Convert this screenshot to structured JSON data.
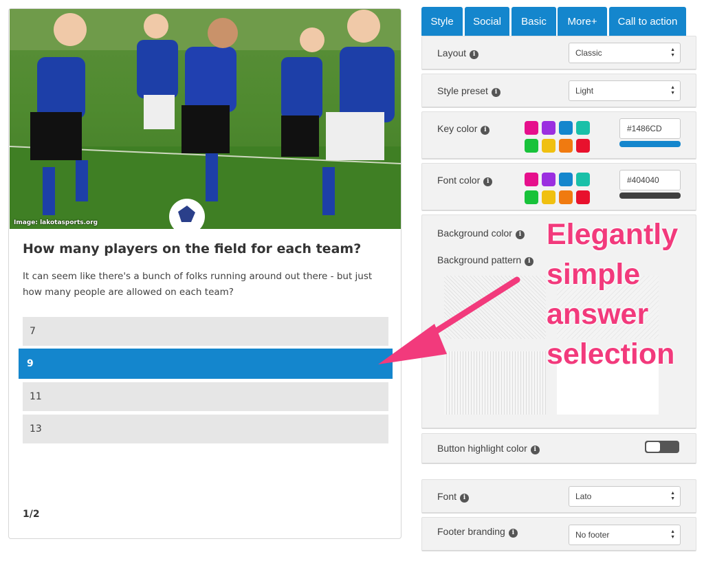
{
  "quiz": {
    "image_credit": "Image: lakotasports.org",
    "title": "How many players on the field for each team?",
    "description": "It can seem like there's a bunch of folks running around out there - but just how many people are allowed on each team?",
    "answers": [
      {
        "label": "7",
        "selected": false
      },
      {
        "label": "9",
        "selected": true
      },
      {
        "label": "11",
        "selected": false
      },
      {
        "label": "13",
        "selected": false
      }
    ],
    "progress": "1/2"
  },
  "tabs": [
    {
      "label": "Style",
      "active": true
    },
    {
      "label": "Social",
      "active": false
    },
    {
      "label": "Basic",
      "active": false
    },
    {
      "label": "More+",
      "active": false
    },
    {
      "label": "Call to action",
      "active": false
    }
  ],
  "settings": {
    "layout": {
      "label": "Layout",
      "value": "Classic"
    },
    "style_preset": {
      "label": "Style preset",
      "value": "Light"
    },
    "key_color": {
      "label": "Key color",
      "value": "#1486CD"
    },
    "font_color": {
      "label": "Font color",
      "value": "#404040"
    },
    "background_color": {
      "label": "Background color"
    },
    "background_pattern": {
      "label": "Background pattern"
    },
    "button_highlight": {
      "label": "Button highlight color",
      "enabled": false
    },
    "font": {
      "label": "Font",
      "value": "Lato"
    },
    "footer_branding": {
      "label": "Footer branding",
      "value": "No footer"
    }
  },
  "swatch_colors": [
    "#e6108c",
    "#9b2fe0",
    "#1486CD",
    "#19c0a8",
    "#18c23a",
    "#f0c010",
    "#f07a10",
    "#e8112d"
  ],
  "annotation": {
    "lines": [
      "Elegantly",
      "simple",
      "answer",
      "selection"
    ],
    "color": "#f23a7c"
  },
  "colors": {
    "accent": "#1486CD",
    "font": "#404040",
    "answer_bg": "#e6e6e6"
  }
}
